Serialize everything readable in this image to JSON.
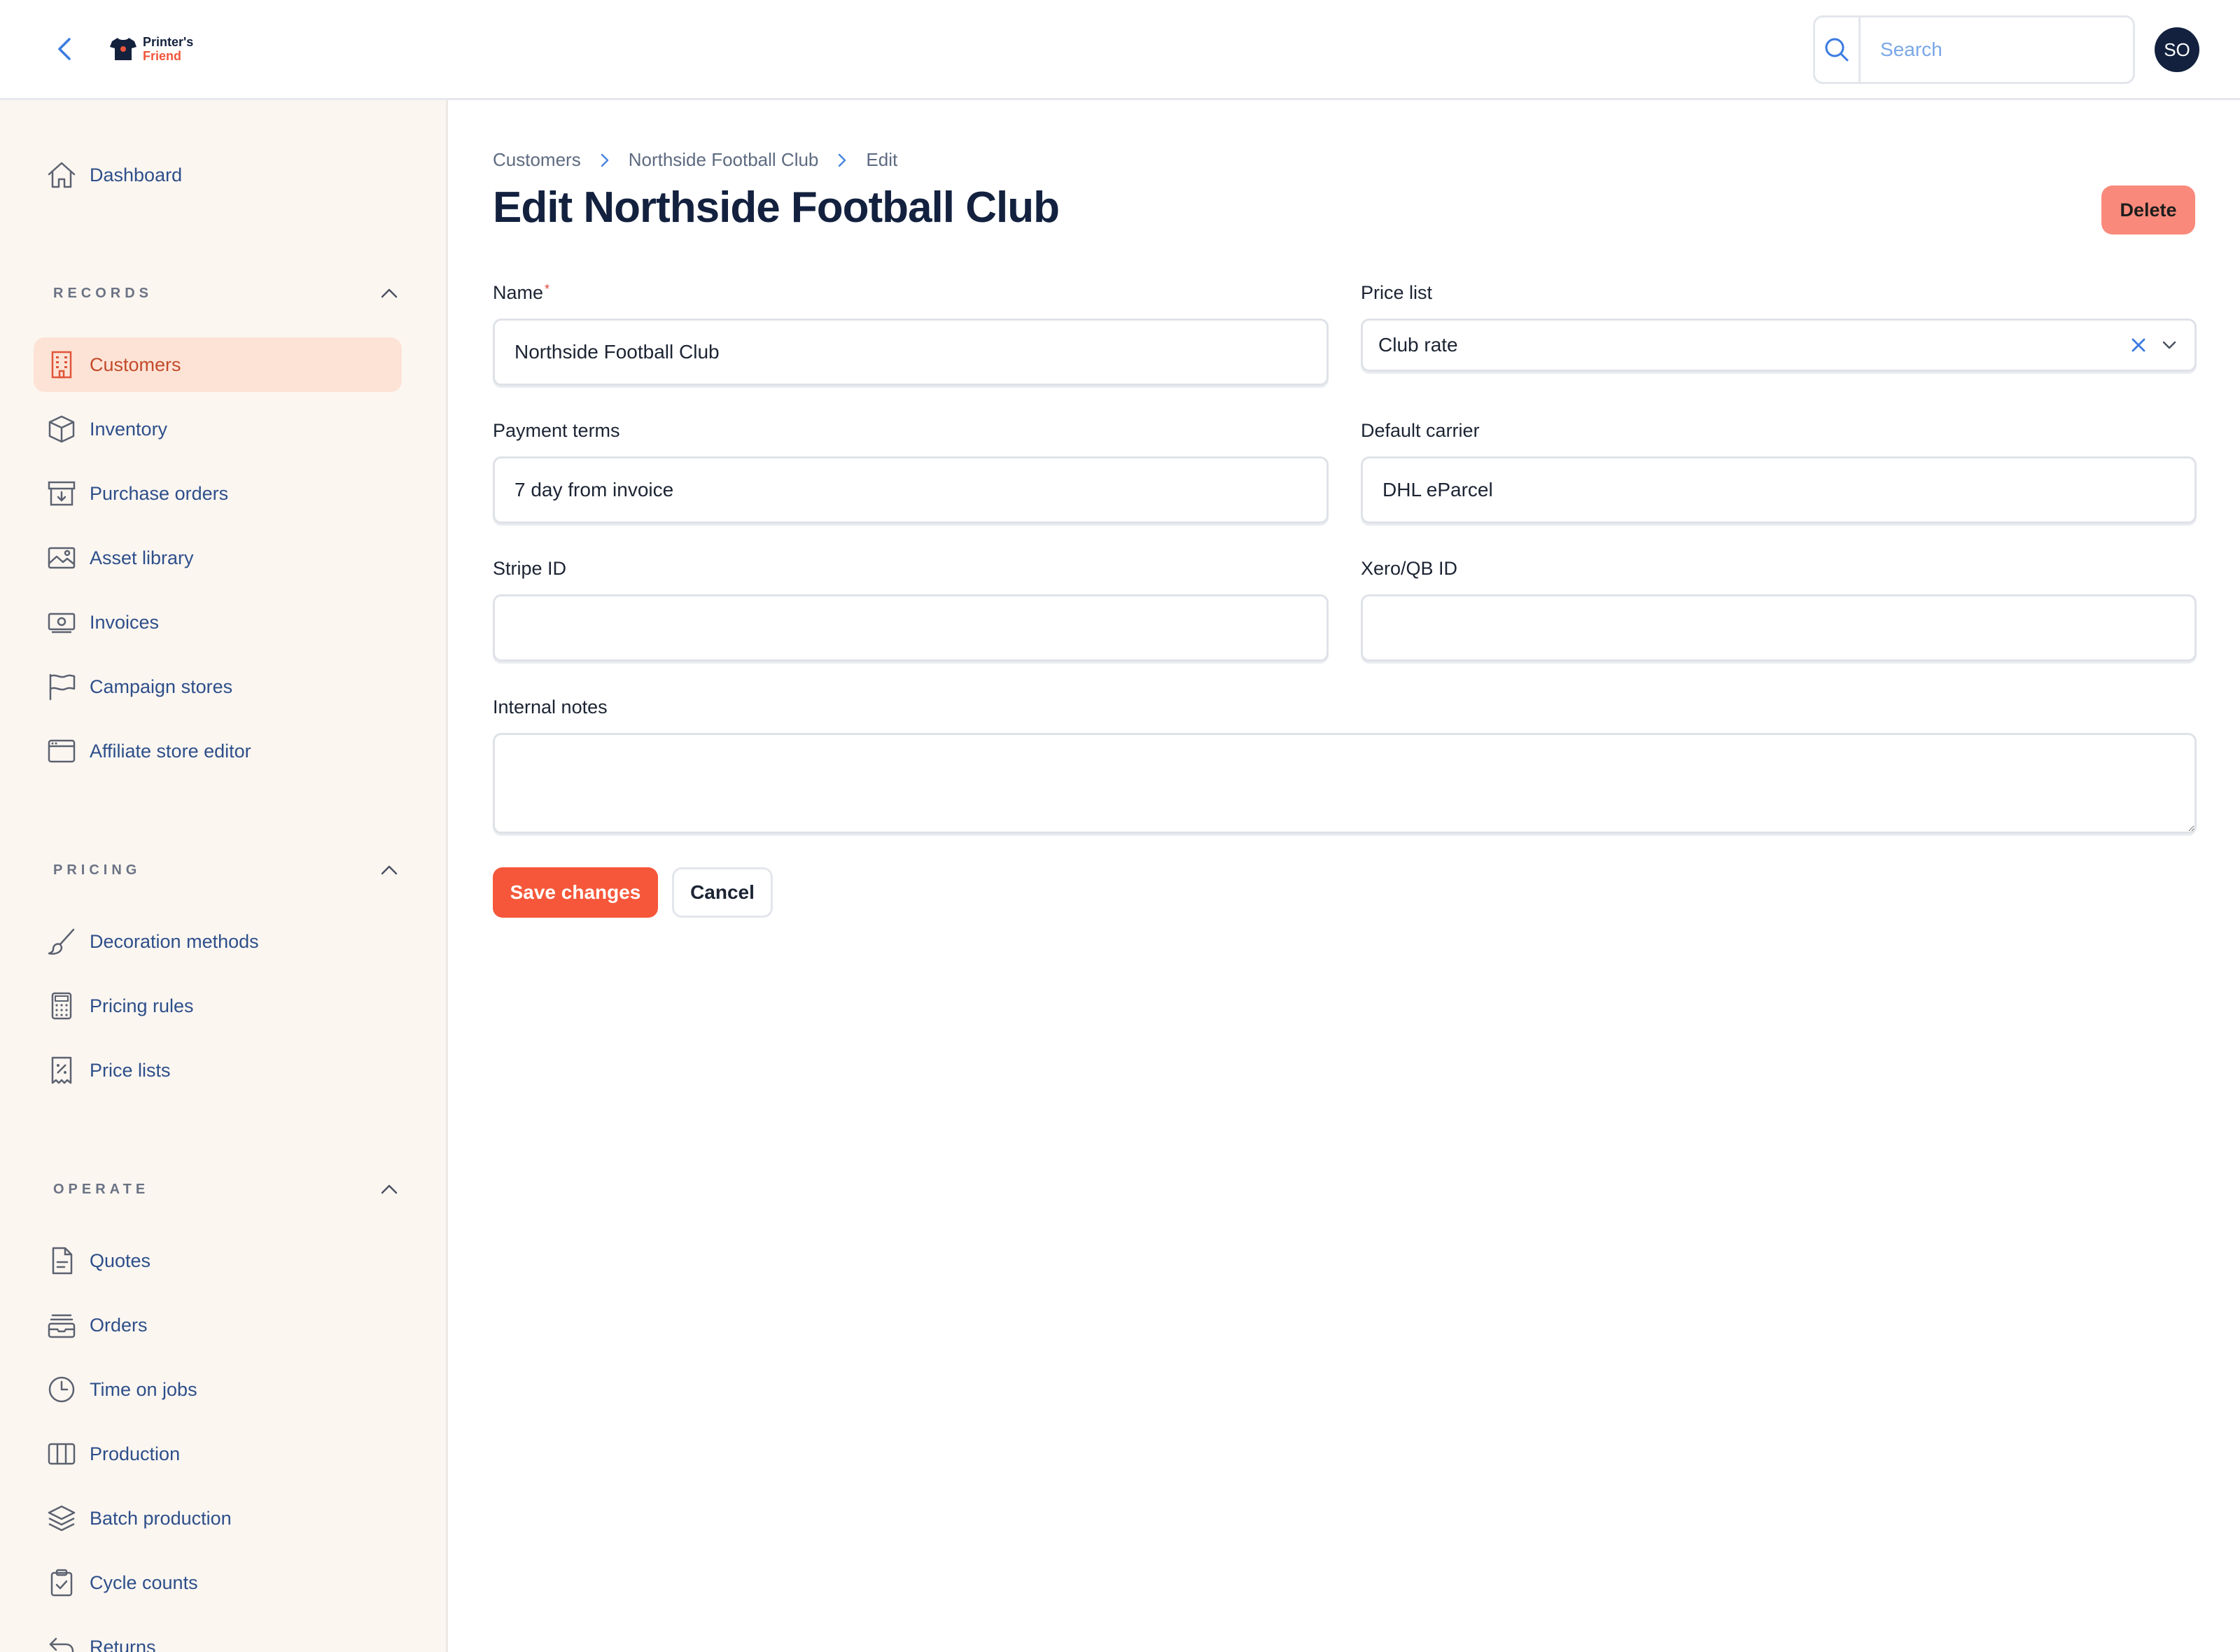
{
  "header": {
    "logo_line1": "Printer's",
    "logo_line2": "Friend",
    "search_placeholder": "Search",
    "avatar_initials": "SO"
  },
  "sidebar": {
    "dashboard": "Dashboard",
    "sections": {
      "records": "RECORDS",
      "pricing": "PRICING",
      "operate": "OPERATE"
    },
    "records_items": [
      {
        "label": "Customers",
        "icon": "building-icon",
        "active": true
      },
      {
        "label": "Inventory",
        "icon": "box-icon"
      },
      {
        "label": "Purchase orders",
        "icon": "archive-icon"
      },
      {
        "label": "Asset library",
        "icon": "image-icon"
      },
      {
        "label": "Invoices",
        "icon": "banknote-icon"
      },
      {
        "label": "Campaign stores",
        "icon": "flag-icon"
      },
      {
        "label": "Affiliate store editor",
        "icon": "browser-icon"
      }
    ],
    "pricing_items": [
      {
        "label": "Decoration methods",
        "icon": "paintbrush-icon"
      },
      {
        "label": "Pricing rules",
        "icon": "calculator-icon"
      },
      {
        "label": "Price lists",
        "icon": "receipt-percent-icon"
      }
    ],
    "operate_items": [
      {
        "label": "Quotes",
        "icon": "document-icon"
      },
      {
        "label": "Orders",
        "icon": "inbox-stack-icon"
      },
      {
        "label": "Time on jobs",
        "icon": "clock-icon"
      },
      {
        "label": "Production",
        "icon": "columns-icon"
      },
      {
        "label": "Batch production",
        "icon": "layers-icon"
      },
      {
        "label": "Cycle counts",
        "icon": "clipboard-check-icon"
      },
      {
        "label": "Returns",
        "icon": "return-arrow-icon"
      }
    ]
  },
  "breadcrumb": [
    "Customers",
    "Northside Football Club",
    "Edit"
  ],
  "page": {
    "title": "Edit Northside Football Club",
    "delete_label": "Delete"
  },
  "form": {
    "name_label": "Name",
    "name_value": "Northside Football Club",
    "price_list_label": "Price list",
    "price_list_value": "Club rate",
    "payment_terms_label": "Payment terms",
    "payment_terms_value": "7 day from invoice",
    "default_carrier_label": "Default carrier",
    "default_carrier_value": "DHL eParcel",
    "stripe_id_label": "Stripe ID",
    "stripe_id_value": "",
    "xero_id_label": "Xero/QB ID",
    "xero_id_value": "",
    "internal_notes_label": "Internal notes",
    "internal_notes_value": "",
    "save_label": "Save changes",
    "cancel_label": "Cancel"
  },
  "colors": {
    "accent": "#f6573a",
    "delete": "#f98a7b",
    "sidebar_bg": "#fcf6f1",
    "active_bg": "#fce3d6",
    "link": "#2d4f8a",
    "title": "#13213f"
  }
}
